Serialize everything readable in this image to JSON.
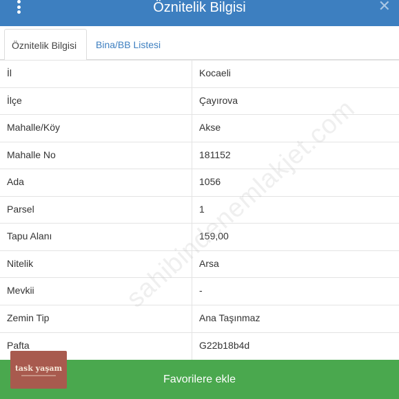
{
  "header": {
    "title": "Öznitelik Bilgisi",
    "menu_icon": "vertical-dots-icon",
    "close_icon": "close-icon",
    "background": "#3d7fc0"
  },
  "tabs": [
    {
      "label": "Öznitelik Bilgisi",
      "active": true
    },
    {
      "label": "Bina/BB Listesi",
      "active": false
    }
  ],
  "rows": [
    {
      "label": "İl",
      "value": "Kocaeli"
    },
    {
      "label": "İlçe",
      "value": "Çayırova"
    },
    {
      "label": "Mahalle/Köy",
      "value": "Akse"
    },
    {
      "label": "Mahalle No",
      "value": "181152"
    },
    {
      "label": "Ada",
      "value": "1056"
    },
    {
      "label": "Parsel",
      "value": "1"
    },
    {
      "label": "Tapu Alanı",
      "value": "159,00"
    },
    {
      "label": "Nitelik",
      "value": "Arsa"
    },
    {
      "label": "Mevkii",
      "value": "-"
    },
    {
      "label": "Zemin Tip",
      "value": "Ana Taşınmaz"
    },
    {
      "label": "Pafta",
      "value": "G22b18b4d"
    }
  ],
  "watermark": "sahibindenemlakjet.com",
  "footer": {
    "favorite_label": "Favorilere ekle",
    "background": "#4aa84e"
  },
  "logo": {
    "text": "task yaşam"
  }
}
